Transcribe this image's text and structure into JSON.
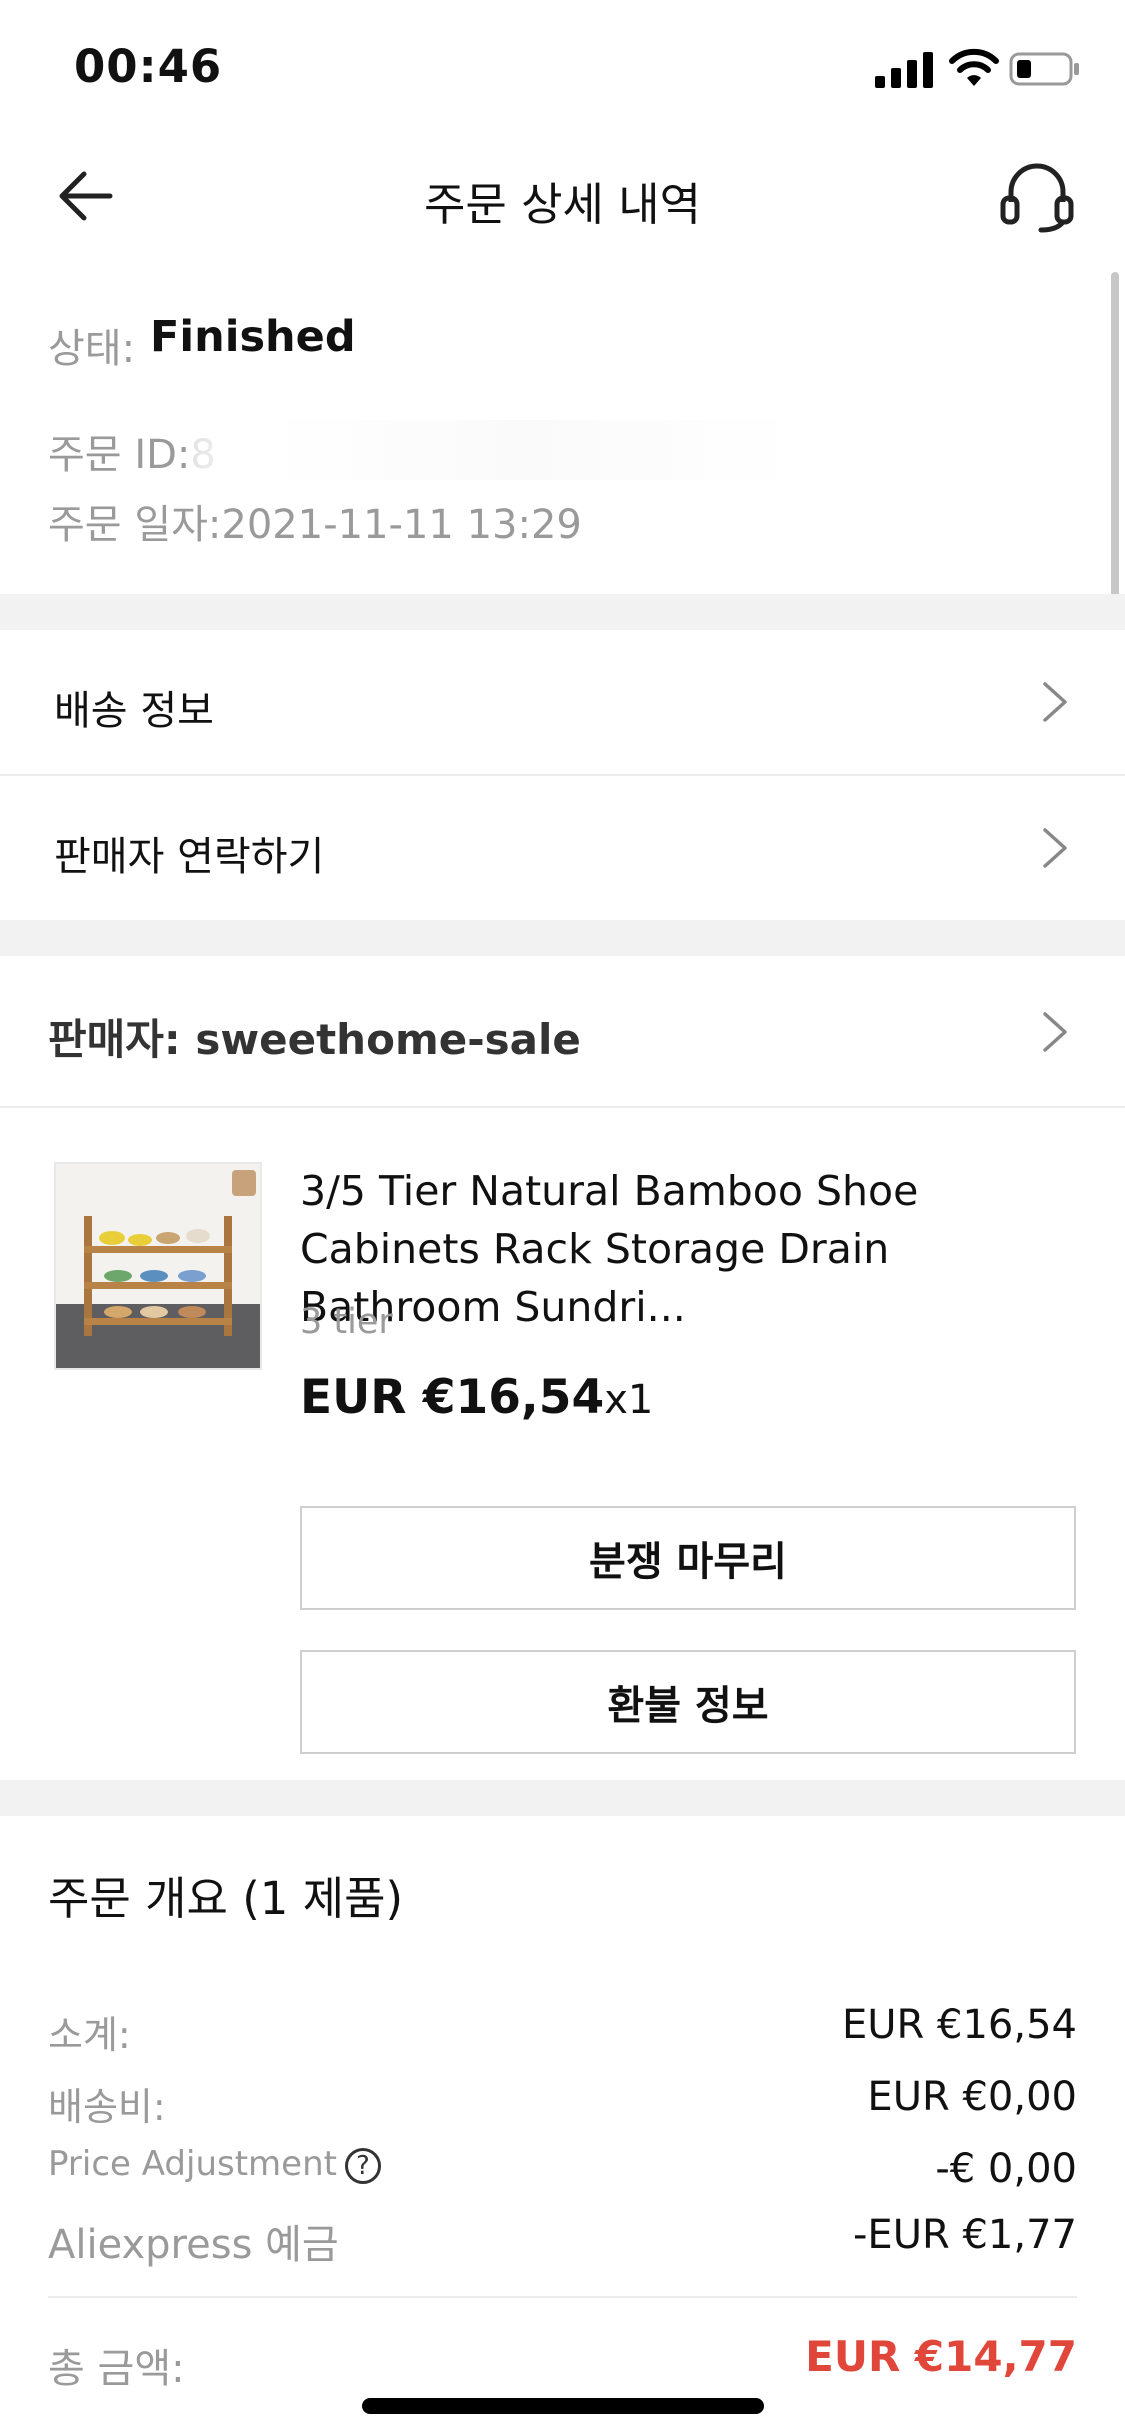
{
  "status_bar": {
    "time": "00:46"
  },
  "header": {
    "title": "주문 상세 내역"
  },
  "order": {
    "status_label": "상태:",
    "status_value": "Finished",
    "id_label": "주문 ID:8",
    "date_text": "주문 일자:2021-11-11 13:29"
  },
  "menu": {
    "shipping": "배송 정보",
    "contact_seller": "판매자 연락하기"
  },
  "seller": {
    "label": "판매자: sweethome-sale"
  },
  "product": {
    "name": "3/5 Tier Natural Bamboo Shoe Cabinets Rack Storage Drain Bathroom Sundri...",
    "variant": "3 tier",
    "price": "EUR €16,54",
    "quantity": "x1"
  },
  "buttons": {
    "dispute": "분쟁 마무리",
    "refund": "환불 정보"
  },
  "summary": {
    "title": "주문 개요 (1 제품)",
    "rows": [
      {
        "label": "소계:",
        "value": "EUR €16,54"
      },
      {
        "label": "배송비:",
        "value": "EUR €0,00"
      },
      {
        "label": "Price Adjustment",
        "value": "-€ 0,00"
      },
      {
        "label": "Aliexpress 예금",
        "value": "-EUR €1,77"
      }
    ],
    "total_label": "총 금액:",
    "total_value": "EUR €14,77"
  },
  "colors": {
    "accent": "#e0463a",
    "gap": "#f2f2f2",
    "muted": "#9a9a9a"
  },
  "icons": {
    "back": "arrow-left-icon",
    "support": "headset-icon",
    "chevron": "chevron-right-icon",
    "help": "question-circle-icon"
  }
}
